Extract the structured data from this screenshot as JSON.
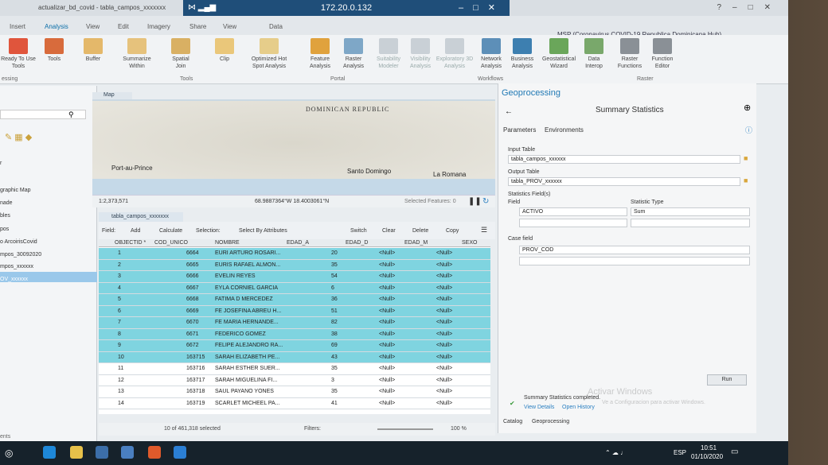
{
  "window": {
    "title_left": "actualizar_bd_covid - tabla_campos_xxxxxxx",
    "rdp_ip": "172.20.0.132",
    "hub_text": "MSP (Coronavirus COVID-19 Republica Dominicana Hub)"
  },
  "menu": {
    "tabs": [
      "Insert",
      "Analysis",
      "View",
      "Edit",
      "Imagery",
      "Share",
      "View"
    ],
    "data_tab": "Data",
    "active": "Analysis"
  },
  "ribbon": {
    "ready_to_use": "Ready To Use Tools",
    "tools": "Tools",
    "buffer": "Buffer",
    "summarize": "Summarize Within",
    "spatial_join": "Spatial Join",
    "clip": "Clip",
    "hotspot": "Optimized Hot Spot Analysis",
    "feature_analysis": "Feature Analysis",
    "raster_analysis": "Raster Analysis",
    "suitability": "Suitability Modeler",
    "visibility": "Visibility Analysis",
    "exploratory": "Exploratory 3D Analysis",
    "network": "Network Analysis",
    "business": "Business Analysis",
    "geostat": "Geostatistical Wizard",
    "data_interop": "Data Interop",
    "raster_functions": "Raster Functions",
    "function_editor": "Function Editor",
    "group_tools": "Tools",
    "group_portal": "Portal",
    "group_workflows": "Workflows",
    "group_raster": "Raster",
    "group_essing": "essing"
  },
  "left_pane": {
    "items": [
      "r",
      "graphic Map",
      "nade",
      "bles",
      "pos",
      "o ArcoirisCovid",
      "mpos_30092020",
      "mpos_xxxxxx",
      "OV_xxxxxx"
    ],
    "bottom_label": "ents"
  },
  "map": {
    "tab": "Map",
    "country": "DOMINICAN REPUBLIC",
    "cities": [
      "Port-au-Prince",
      "Santo Domingo",
      "La Romana"
    ],
    "scale": "1:2,373,571",
    "coords": "68.9887364°W 18.4003061°N",
    "selected_features": "Selected Features: 0"
  },
  "table": {
    "tab": "tabla_campos_xxxxxxx",
    "tool_field": "Field:",
    "tool_add": "Add",
    "tool_calculate": "Calculate",
    "tool_selection": "Selection:",
    "tool_select_by_attr": "Select By Attributes",
    "tool_switch": "Switch",
    "tool_clear": "Clear",
    "tool_delete": "Delete",
    "tool_copy": "Copy",
    "columns": [
      "OBJECTID *",
      "COD_UNICO",
      "NOMBRE",
      "EDAD_A",
      "EDAD_D",
      "EDAD_M",
      "SEXO"
    ],
    "rows": [
      {
        "id": "1",
        "cod": "6664",
        "nombre": "EURI ARTURO ROSARI...",
        "edad_a": "20",
        "edad_d": "<Null>",
        "edad_m": "<Null>",
        "sel": true
      },
      {
        "id": "2",
        "cod": "6665",
        "nombre": "EURIS RAFAEL ALMON...",
        "edad_a": "35",
        "edad_d": "<Null>",
        "edad_m": "<Null>",
        "sel": true
      },
      {
        "id": "3",
        "cod": "6666",
        "nombre": "EVELIN REYES",
        "edad_a": "54",
        "edad_d": "<Null>",
        "edad_m": "<Null>",
        "sel": true
      },
      {
        "id": "4",
        "cod": "6667",
        "nombre": "EYLA CORNIEL GARCIA",
        "edad_a": "6",
        "edad_d": "<Null>",
        "edad_m": "<Null>",
        "sel": true
      },
      {
        "id": "5",
        "cod": "6668",
        "nombre": "FATIMA D MERCEDEZ",
        "edad_a": "36",
        "edad_d": "<Null>",
        "edad_m": "<Null>",
        "sel": true
      },
      {
        "id": "6",
        "cod": "6669",
        "nombre": "FE JOSEFINA ABREU H...",
        "edad_a": "51",
        "edad_d": "<Null>",
        "edad_m": "<Null>",
        "sel": true
      },
      {
        "id": "7",
        "cod": "6670",
        "nombre": "FE MARIA HERNANDE...",
        "edad_a": "82",
        "edad_d": "<Null>",
        "edad_m": "<Null>",
        "sel": true
      },
      {
        "id": "8",
        "cod": "6671",
        "nombre": "FEDERICO GOMEZ",
        "edad_a": "38",
        "edad_d": "<Null>",
        "edad_m": "<Null>",
        "sel": true
      },
      {
        "id": "9",
        "cod": "6672",
        "nombre": "FELIPE ALEJANDRO RA...",
        "edad_a": "69",
        "edad_d": "<Null>",
        "edad_m": "<Null>",
        "sel": true
      },
      {
        "id": "10",
        "cod": "163715",
        "nombre": "SARAH ELIZABETH PE...",
        "edad_a": "43",
        "edad_d": "<Null>",
        "edad_m": "<Null>",
        "sel": true
      },
      {
        "id": "11",
        "cod": "163716",
        "nombre": "SARAH ESTHER SUER...",
        "edad_a": "35",
        "edad_d": "<Null>",
        "edad_m": "<Null>",
        "sel": false
      },
      {
        "id": "12",
        "cod": "163717",
        "nombre": "SARAH MIGUELINA FI...",
        "edad_a": "3",
        "edad_d": "<Null>",
        "edad_m": "<Null>",
        "sel": false
      },
      {
        "id": "13",
        "cod": "163718",
        "nombre": "SAUL PAYANO YONES",
        "edad_a": "35",
        "edad_d": "<Null>",
        "edad_m": "<Null>",
        "sel": false
      },
      {
        "id": "14",
        "cod": "163719",
        "nombre": "SCARLET MICHEEL PA...",
        "edad_a": "41",
        "edad_d": "<Null>",
        "edad_m": "<Null>",
        "sel": false
      }
    ],
    "status": "10 of 461,318 selected",
    "filters": "Filters:",
    "zoom": "100 %"
  },
  "geoprocessing": {
    "header": "Geoprocessing",
    "tool_title": "Summary Statistics",
    "tab_parameters": "Parameters",
    "tab_environments": "Environments",
    "input_table_label": "Input Table",
    "input_table_value": "tabla_campos_xxxxxx",
    "output_table_label": "Output Table",
    "output_table_value": "tabla_PROV_xxxxxx",
    "stat_fields_label": "Statistics Field(s)",
    "field_label": "Field",
    "stat_type_label": "Statistic Type",
    "field_value": "ACTIVO",
    "stat_value": "Sum",
    "case_field_label": "Case field",
    "case_field_value": "PROV_COD",
    "run": "Run",
    "completed": "Summary Statistics completed.",
    "view_details": "View Details",
    "open_history": "Open History",
    "watermark": "Activar Windows",
    "watermark_sub": "Ve a Configuracion para activar Windows.",
    "bottom_catalog": "Catalog",
    "bottom_geoprocessing": "Geoprocessing"
  },
  "taskbar": {
    "lang": "ESP",
    "time": "10:51",
    "date": "01/10/2020"
  }
}
